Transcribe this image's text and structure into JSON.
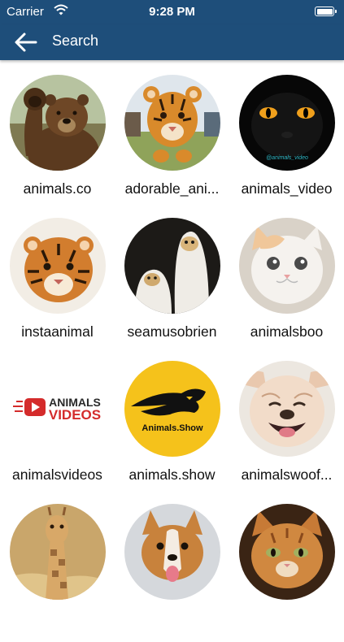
{
  "status_bar": {
    "carrier": "Carrier",
    "time": "9:28 PM"
  },
  "nav": {
    "title": "Search"
  },
  "colors": {
    "nav_background": "#1e4e7a"
  },
  "accounts": [
    {
      "name": "animals.co",
      "image": "bear-waving"
    },
    {
      "name": "adorable_ani...",
      "image": "tiger-cub-grass"
    },
    {
      "name": "animals_video",
      "image": "black-panther",
      "image_caption": "@animals_video"
    },
    {
      "name": "instaanimal",
      "image": "tiger-cub"
    },
    {
      "name": "seamusobrien",
      "image": "dogs-in-ghost-costumes"
    },
    {
      "name": "animalsboo",
      "image": "white-cat"
    },
    {
      "name": "animalsvideos",
      "image": "animals-videos-logo",
      "logo_text": [
        "ANIMALS",
        "VIDEOS"
      ]
    },
    {
      "name": "animals.show",
      "image": "animals-show-logo",
      "logo_text": "Animals.Show"
    },
    {
      "name": "animalswoof...",
      "image": "smiling-bulldog"
    },
    {
      "name": "",
      "image": "baby-giraffe"
    },
    {
      "name": "",
      "image": "corgi-puppy"
    },
    {
      "name": "",
      "image": "orange-kitten"
    }
  ]
}
